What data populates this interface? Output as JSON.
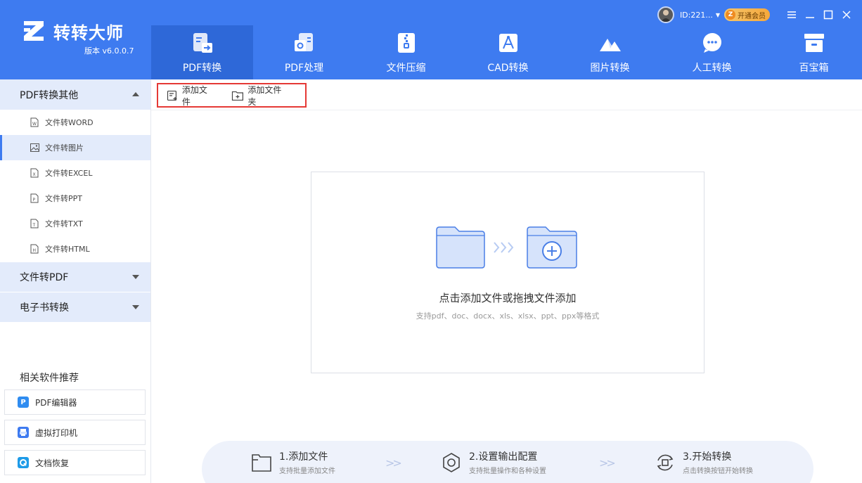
{
  "app": {
    "name": "转转大师",
    "version": "版本 v6.0.0.7",
    "user_id": "ID:221...",
    "vip_label": "开通会员",
    "vip_badge": "Z"
  },
  "colors": {
    "brand": "#3e7bf0",
    "nav_active": "#2e68d8",
    "sidebar_highlight": "#e3ebfb",
    "toolbar_highlight_border": "#e53935"
  },
  "nav": [
    {
      "label": "PDF转换",
      "icon": "pdf-convert-icon",
      "active": true
    },
    {
      "label": "PDF处理",
      "icon": "pdf-process-icon",
      "active": false
    },
    {
      "label": "文件压缩",
      "icon": "file-compress-icon",
      "active": false
    },
    {
      "label": "CAD转换",
      "icon": "cad-convert-icon",
      "active": false
    },
    {
      "label": "图片转换",
      "icon": "image-convert-icon",
      "active": false
    },
    {
      "label": "人工转换",
      "icon": "manual-convert-icon",
      "active": false
    },
    {
      "label": "百宝箱",
      "icon": "toolbox-icon",
      "active": false
    }
  ],
  "sidebar": {
    "groups": [
      {
        "label": "PDF转换其他",
        "expanded": true,
        "items": [
          {
            "label": "文件转WORD",
            "icon": "word-file-icon",
            "selected": false
          },
          {
            "label": "文件转图片",
            "icon": "image-file-icon",
            "selected": true
          },
          {
            "label": "文件转EXCEL",
            "icon": "excel-file-icon",
            "selected": false
          },
          {
            "label": "文件转PPT",
            "icon": "ppt-file-icon",
            "selected": false
          },
          {
            "label": "文件转TXT",
            "icon": "txt-file-icon",
            "selected": false
          },
          {
            "label": "文件转HTML",
            "icon": "html-file-icon",
            "selected": false
          }
        ]
      },
      {
        "label": "文件转PDF",
        "expanded": false
      },
      {
        "label": "电子书转换",
        "expanded": false
      }
    ],
    "recommend_title": "相关软件推荐",
    "recommend": [
      {
        "label": "PDF编辑器",
        "icon": "pdf-editor-icon"
      },
      {
        "label": "虚拟打印机",
        "icon": "virtual-printer-icon"
      },
      {
        "label": "文档恢复",
        "icon": "document-recovery-icon"
      }
    ]
  },
  "toolbar": {
    "add_file": "添加文件",
    "add_folder": "添加文件夹"
  },
  "dropzone": {
    "main_text": "点击添加文件或拖拽文件添加",
    "sub_text": "支持pdf、doc、docx、xls、xlsx、ppt、ppx等格式"
  },
  "steps": [
    {
      "title": "1.添加文件",
      "desc": "支持批量添加文件"
    },
    {
      "title": "2.设置输出配置",
      "desc": "支持批量操作和各种设置"
    },
    {
      "title": "3.开始转换",
      "desc": "点击转换按钮开始转换"
    }
  ]
}
